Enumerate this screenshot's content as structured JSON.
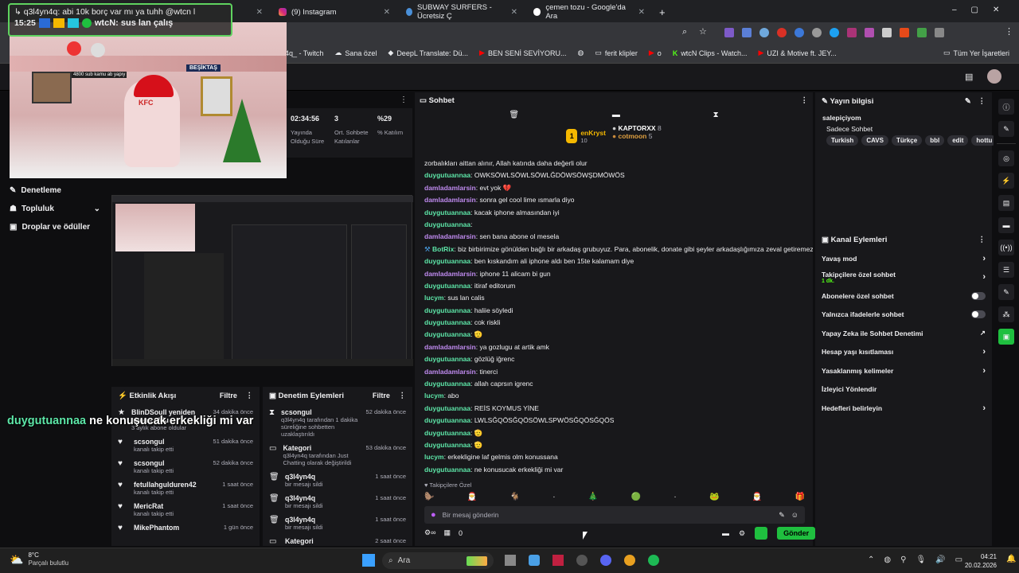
{
  "browser": {
    "tabs": [
      {
        "label": "(9) Instagram"
      },
      {
        "label": "SUBWAY SURFERS - Ücretsiz Ç"
      },
      {
        "label": "çemen tozu - Google'da Ara"
      }
    ],
    "bookmarks": [
      "4q_ - Twitch",
      "Sana özel",
      "DeepL Translate: Dü...",
      "BEN SENİ SEVİYORU...",
      "",
      "ferit klipler",
      "o",
      "wtcN Clips - Watch...",
      "UZI & Motive ft. JEY..."
    ],
    "all_bookmarks": "Tüm Yer İşaretleri"
  },
  "overlay": {
    "line1": "q3l4yn4q: abi 10k borç var mı ya tuhh @wtcn l",
    "time": "15:25",
    "line2": "wtcN: sus lan çalış",
    "banner": "BEŞİKTAŞ",
    "shirt": "KFC",
    "caption": "4800 sub kamu ab yapıy"
  },
  "stats": {
    "items": [
      {
        "value": "02:34:56",
        "label": "Yayında Olduğu Süre"
      },
      {
        "value": "3",
        "label": "Ort. Sohbete Katılanlar"
      },
      {
        "value": "%29",
        "label": "% Katılım"
      }
    ]
  },
  "nav": {
    "items": [
      "Denetleme",
      "Topluluk",
      "Droplar ve ödüller"
    ]
  },
  "floating": {
    "user": "duygutuannaa",
    "msg": "ne konuşucak erkekliği mi var"
  },
  "activity": {
    "title": "Etkinlik Akışı",
    "filter": "Filtre",
    "events": [
      {
        "name": "BlinDSoull yeniden abone oldu",
        "sub": "3 aylık abone oldular",
        "time": "34 dakika önce"
      },
      {
        "name": "scsongul",
        "sub": "kanalı takip etti",
        "time": "51 dakika önce"
      },
      {
        "name": "scsongul",
        "sub": "kanalı takip etti",
        "time": "52 dakika önce"
      },
      {
        "name": "fetullahgulduren42",
        "sub": "kanalı takip etti",
        "time": "1 saat önce"
      },
      {
        "name": "MericRat",
        "sub": "kanalı takip etti",
        "time": "1 saat önce"
      },
      {
        "name": "MikePhantom",
        "sub": "",
        "time": "1 gün önce"
      }
    ]
  },
  "modactions": {
    "title": "Denetim Eylemleri",
    "filter": "Filtre",
    "events": [
      {
        "name": "scsongul",
        "sub": "q3l4yn4q tarafından 1 dakika süreliğine sohbetten uzaklaştırıldı",
        "time": "52 dakika önce"
      },
      {
        "name": "Kategori",
        "sub": "q3l4yn4q tarafından Just Chatting olarak değiştirildi",
        "time": "53 dakika önce"
      },
      {
        "name": "q3l4yn4q",
        "sub": "bir mesajı sildi",
        "time": "1 saat önce"
      },
      {
        "name": "q3l4yn4q",
        "sub": "bir mesajı sildi",
        "time": "1 saat önce"
      },
      {
        "name": "q3l4yn4q",
        "sub": "bir mesajı sildi",
        "time": "1 saat önce"
      },
      {
        "name": "Kategori",
        "sub": "",
        "time": "2 saat önce"
      }
    ]
  },
  "chat": {
    "title": "Sohbet",
    "leaders": [
      {
        "name": "enKryst",
        "count": "10"
      },
      {
        "name": "KAPTORXX",
        "count": "8"
      },
      {
        "name": "cotmoon",
        "count": "5"
      }
    ],
    "messages": [
      {
        "user": "",
        "text": "zorbalıkları aittan alınır, Allah katında daha değerli olur",
        "cls": "u-d"
      },
      {
        "user": "duygutuannaa",
        "text": "OWKSÖWLSÖWLSÖWLĞDÖWSÖWŞDMÖWÖS",
        "cls": "u-d"
      },
      {
        "user": "damladamlarsin",
        "text": "evt yok 💔",
        "cls": "u-m"
      },
      {
        "user": "damladamlarsin",
        "text": "sonra gel cool lime ısmarla diyo",
        "cls": "u-m"
      },
      {
        "user": "duygutuannaa",
        "text": "kacak iphone almasından iyi",
        "cls": "u-d"
      },
      {
        "user": "duygutuannaa",
        "text": "",
        "cls": "u-d"
      },
      {
        "user": "damladamlarsin",
        "text": "sen bana abone ol mesela",
        "cls": "u-m"
      },
      {
        "user": "BotRix",
        "text": "biz birbirimize gönülden bağlı bir arkadaş grubuyuz. Para, abonelik, donate gibi şeyler arkadaşlığımıza zeval getiremez.",
        "cls": "u-b"
      },
      {
        "user": "duygutuannaa",
        "text": "ben kıskandım ali iphone aldı ben 15te kalamam diye",
        "cls": "u-d"
      },
      {
        "user": "damladamlarsin",
        "text": "iphone 11 alicam bi gun",
        "cls": "u-m"
      },
      {
        "user": "duygutuannaa",
        "text": "itiraf editorum",
        "cls": "u-d"
      },
      {
        "user": "lucym",
        "text": "sus lan calis",
        "cls": "u-l"
      },
      {
        "user": "duygutuannaa",
        "text": "haliie söyledi",
        "cls": "u-d"
      },
      {
        "user": "duygutuannaa",
        "text": "cok riskli",
        "cls": "u-d"
      },
      {
        "user": "duygutuannaa",
        "text": "🫡",
        "cls": "u-d"
      },
      {
        "user": "damladamlarsin",
        "text": "ya gozlugu at artik amk",
        "cls": "u-m"
      },
      {
        "user": "duygutuannaa",
        "text": "gözlüğ iğrenc",
        "cls": "u-d"
      },
      {
        "user": "damladamlarsin",
        "text": "tinerci",
        "cls": "u-m"
      },
      {
        "user": "duygutuannaa",
        "text": "allah caprsın igrenc",
        "cls": "u-d"
      },
      {
        "user": "lucym",
        "text": "abo",
        "cls": "u-l"
      },
      {
        "user": "duygutuannaa",
        "text": "REİS KOYMUS YİNE",
        "cls": "u-d"
      },
      {
        "user": "duygutuannaa",
        "text": "LWLSĞQÖSĞQÖSÖWLSPWÖSĞQÖSĞQÖS",
        "cls": "u-d"
      },
      {
        "user": "duygutuannaa",
        "text": "🫡",
        "cls": "u-d"
      },
      {
        "user": "duygutuannaa",
        "text": "🫡",
        "cls": "u-d"
      },
      {
        "user": "lucym",
        "text": "erkekligine laf gelmis olm konussana",
        "cls": "u-l"
      },
      {
        "user": "duygutuannaa",
        "text": "ne konusucak erkekliği mi var",
        "cls": "u-d"
      }
    ],
    "followers_only": "Takipçilere Özel",
    "placeholder": "Bir mesaj gönderin",
    "points": "0",
    "send": "Gönder"
  },
  "stream_info": {
    "title": "Yayın bilgisi",
    "channel": "salepiçiyom",
    "stream_title": "Sadece Sohbet",
    "tags": [
      "Turkish",
      "CAVS",
      "Türkçe",
      "bbl",
      "edit",
      "hottu"
    ]
  },
  "channel_actions": {
    "title": "Kanal Eylemleri",
    "rows": [
      {
        "label": "Yavaş mod",
        "kind": "chev"
      },
      {
        "label": "Takipçilere özel sohbet",
        "sub": "1 dk.",
        "kind": "chev"
      },
      {
        "label": "Abonelere özel sohbet",
        "kind": "toggle"
      },
      {
        "label": "Yalnızca ifadelerle sohbet",
        "kind": "toggle"
      },
      {
        "label": "Yapay Zeka ile Sohbet Denetimi",
        "kind": "ext"
      },
      {
        "label": "Hesap yaşı kısıtlaması",
        "kind": "chev"
      },
      {
        "label": "Yasaklanmış kelimeler",
        "kind": "chev"
      },
      {
        "label": "İzleyici Yönlendir",
        "kind": "none"
      },
      {
        "label": "Hedefleri belirleyin",
        "kind": "chev"
      }
    ]
  },
  "taskbar": {
    "weather_temp": "8°C",
    "weather_desc": "Parçalı bulutlu",
    "search": "Ara",
    "time": "04:21",
    "date": "20.02.2026"
  }
}
